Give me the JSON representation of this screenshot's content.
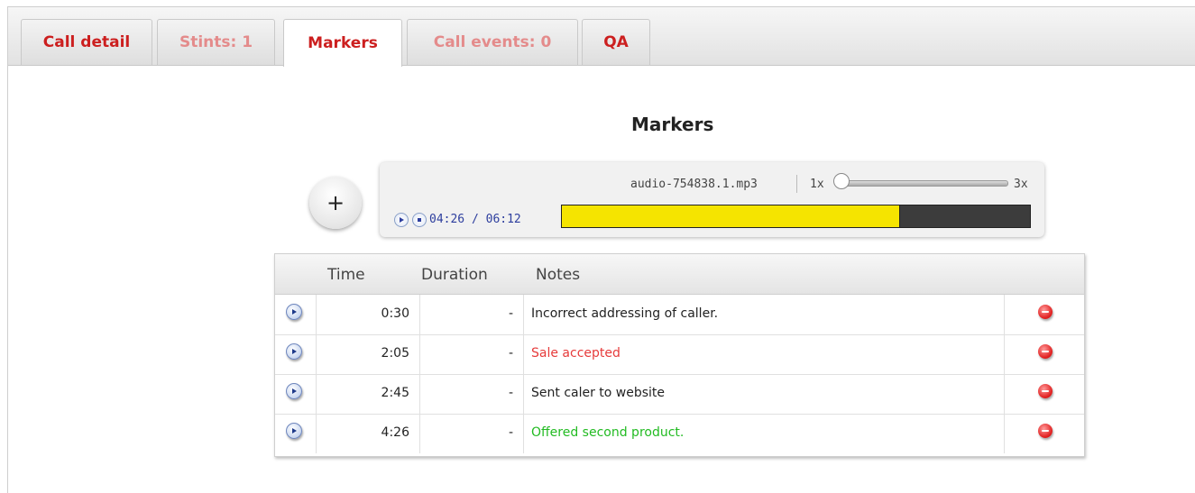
{
  "tabs": [
    {
      "label": "Call detail",
      "state": "normal"
    },
    {
      "label": "Stints: 1",
      "state": "muted"
    },
    {
      "label": "Markers",
      "state": "active"
    },
    {
      "label": "Call events: 0",
      "state": "muted"
    },
    {
      "label": "QA",
      "state": "normal"
    }
  ],
  "main": {
    "heading": "Markers",
    "add_label": "+"
  },
  "player": {
    "filename": "audio-754838.1.mp3",
    "speed_min": "1x",
    "speed_max": "3x",
    "speed_level": 0,
    "time_display": "04:26 / 06:12",
    "progress_fraction": 0.72
  },
  "table": {
    "headers": [
      "Time",
      "Duration",
      "Notes"
    ],
    "rows": [
      {
        "time": "0:30",
        "duration": "-",
        "note": "Incorrect addressing of caller.",
        "note_color": "#222222"
      },
      {
        "time": "2:05",
        "duration": "-",
        "note": "Sale accepted",
        "note_color": "#e63b3b"
      },
      {
        "time": "2:45",
        "duration": "-",
        "note": "Sent caler to website",
        "note_color": "#222222"
      },
      {
        "time": "4:26",
        "duration": "-",
        "note": "Offered second product.",
        "note_color": "#22bb22"
      }
    ]
  },
  "colors": {
    "tab_accent": "#cc1f1f",
    "tab_muted": "#e48b8b",
    "progress_fill": "#f5e400",
    "progress_bg": "#3c3c3c"
  },
  "icons": {
    "row_play": "play-circle-icon",
    "row_delete": "minus-circle-icon",
    "player_play": "play-icon",
    "player_stop": "stop-icon"
  }
}
